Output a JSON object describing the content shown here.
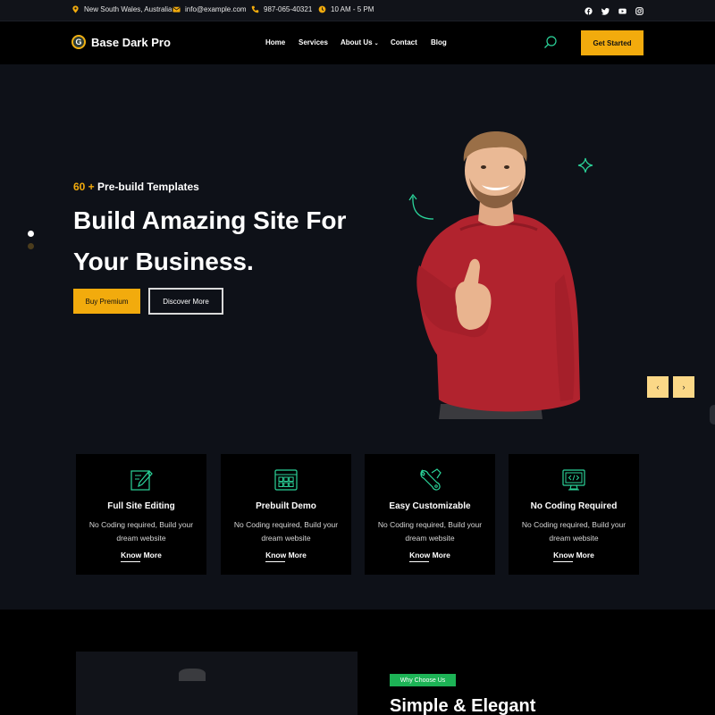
{
  "topbar": {
    "location": "New South Wales, Australia",
    "email": "info@example.com",
    "phone": "987-065-40321",
    "hours": "10 AM - 5 PM",
    "social": [
      "facebook-icon",
      "twitter-icon",
      "youtube-icon",
      "instagram-icon"
    ]
  },
  "nav": {
    "logo_letter": "G",
    "brand": "Base Dark Pro",
    "links": [
      "Home",
      "Services",
      "About Us",
      "Contact",
      "Blog"
    ],
    "cta": "Get Started"
  },
  "hero": {
    "eyebrow_count": "60 +",
    "eyebrow_text": " Pre-build Templates",
    "title_line1": "Build Amazing Site For",
    "title_line2": "Your Business.",
    "primary_button": "Buy Premium",
    "secondary_button": "Discover More",
    "prev": "‹",
    "next": "›"
  },
  "features": [
    {
      "title": "Full Site Editing",
      "desc": "No Coding required, Build your dream website",
      "link": "Know More",
      "icon": "edit-icon"
    },
    {
      "title": "Prebuilt Demo",
      "desc": "No Coding required, Build your dream website",
      "link": "Know More",
      "icon": "grid-window-icon"
    },
    {
      "title": "Easy Customizable",
      "desc": "No Coding required, Build your dream website",
      "link": "Know More",
      "icon": "wrench-icon"
    },
    {
      "title": "No Coding Required",
      "desc": "No Coding required, Build your dream website",
      "link": "Know More",
      "icon": "code-monitor-icon"
    }
  ],
  "section": {
    "badge": "Why Choose Us",
    "title": "Simple & Elegant"
  },
  "colors": {
    "accent": "#f2ab0d",
    "green": "#1db356",
    "icon_teal": "#2bd49a",
    "background": "#0e1118"
  }
}
